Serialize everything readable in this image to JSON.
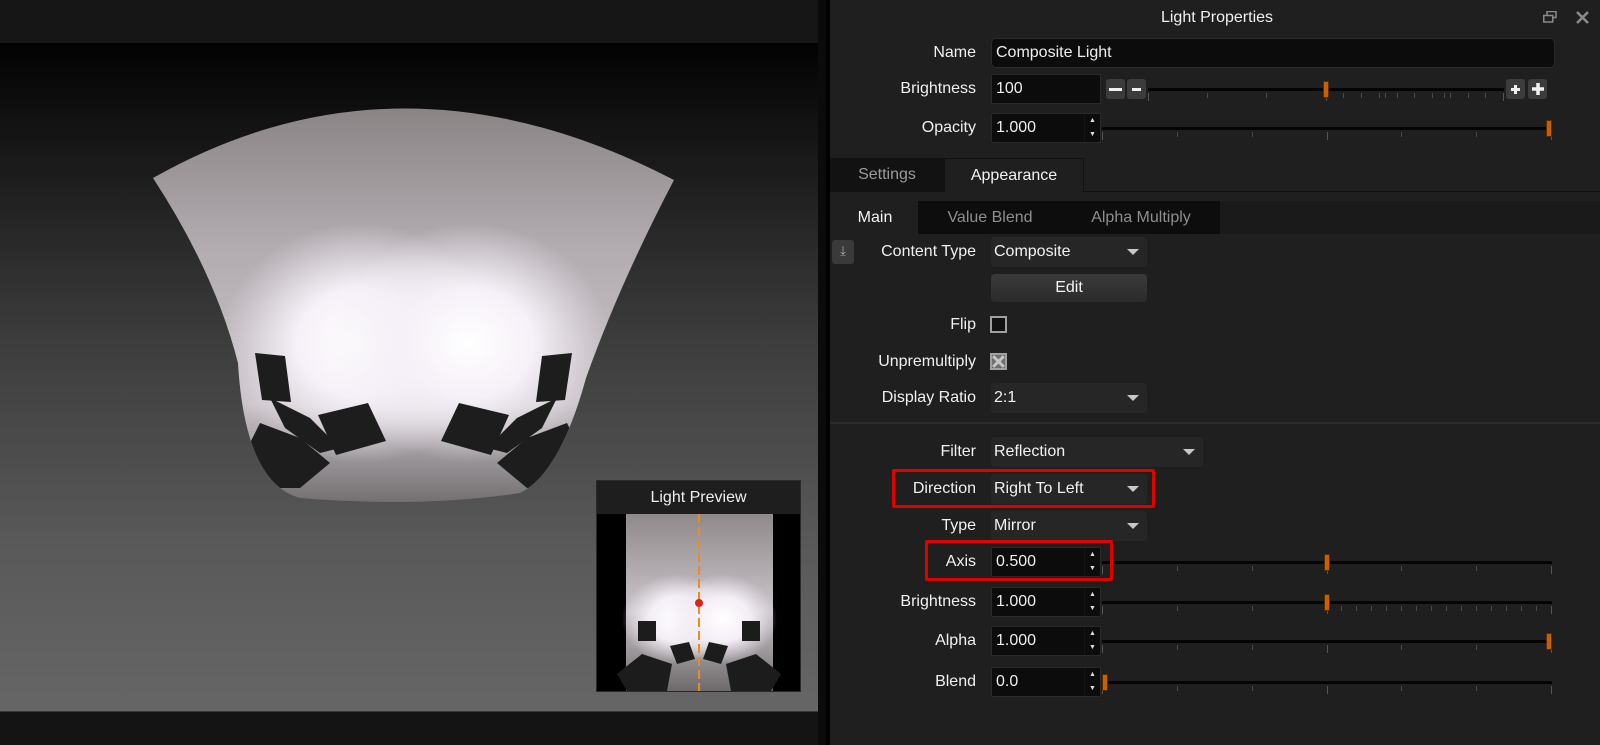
{
  "viewport": {
    "preview": {
      "title": "Light Preview",
      "axis_line_color": "#f08a1c",
      "center_dot_color": "#e02020"
    }
  },
  "panel": {
    "title": "Light Properties",
    "icons": {
      "restore": "restore-window-icon",
      "close": "close-icon"
    },
    "name": {
      "label": "Name",
      "value": "Composite Light"
    },
    "brightness": {
      "label": "Brightness",
      "value": "100",
      "slider_fraction": 0.5
    },
    "opacity": {
      "label": "Opacity",
      "value": "1.000",
      "slider_fraction": 1.0
    },
    "tabs": [
      {
        "label": "Settings",
        "active": false
      },
      {
        "label": "Appearance",
        "active": true
      }
    ],
    "subtabs": [
      {
        "label": "Main",
        "active": true
      },
      {
        "label": "Value Blend",
        "active": false
      },
      {
        "label": "Alpha Multiply",
        "active": false
      }
    ],
    "content_type": {
      "label": "Content Type",
      "value": "Composite"
    },
    "edit_label": "Edit",
    "flip": {
      "label": "Flip",
      "checked": false
    },
    "unpremultiply": {
      "label": "Unpremultiply",
      "checked": true
    },
    "display_ratio": {
      "label": "Display Ratio",
      "value": "2:1"
    },
    "filter": {
      "label": "Filter",
      "value": "Reflection"
    },
    "direction": {
      "label": "Direction",
      "value": "Right To Left"
    },
    "type": {
      "label": "Type",
      "value": "Mirror"
    },
    "axis": {
      "label": "Axis",
      "value": "0.500",
      "slider_fraction": 0.5
    },
    "filter_brightness": {
      "label": "Brightness",
      "value": "1.000",
      "slider_fraction": 0.5
    },
    "alpha": {
      "label": "Alpha",
      "value": "1.000",
      "slider_fraction": 1.0
    },
    "blend": {
      "label": "Blend",
      "value": "0.0",
      "slider_fraction": 0.0
    },
    "accent_color": "#c76000",
    "highlight_color": "#e00000"
  }
}
